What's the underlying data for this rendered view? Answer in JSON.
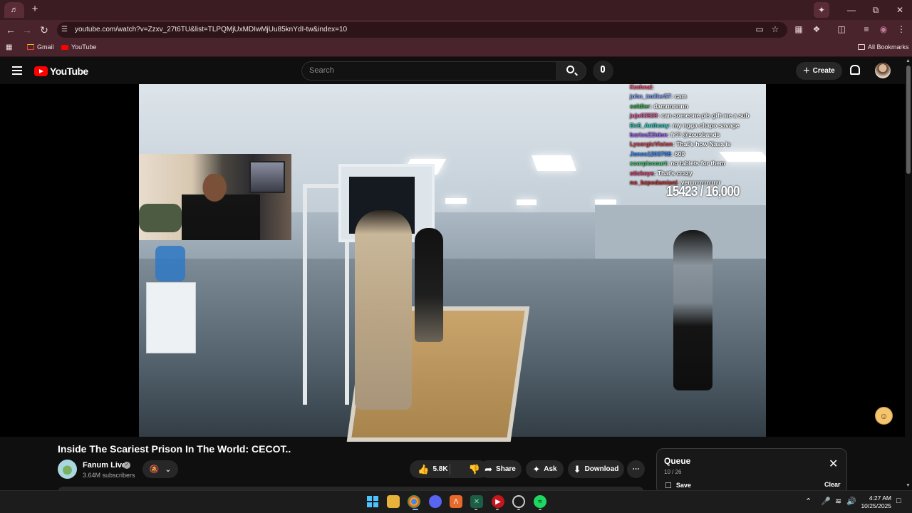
{
  "browser": {
    "url": "youtube.com/watch?v=Zzxv_27t6TU&list=TLPQMjUxMDIwMjUu85knYdI-tw&index=10",
    "bookmarks": [
      "Gmail",
      "YouTube"
    ],
    "all_bookmarks_label": "All Bookmarks"
  },
  "youtube": {
    "logo_text": "YouTube",
    "search_placeholder": "Search",
    "create_label": "Create"
  },
  "video": {
    "title": "Inside The Scariest Prison In The World: CECOT..",
    "overlay_counter": "15423 / 16,000",
    "chat": [
      {
        "user": "Kmhnal",
        "msg": "",
        "color": "#ff4d6d"
      },
      {
        "user": "john_tmiller57",
        "msg": "cam",
        "color": "#8aa8ff"
      },
      {
        "user": "soldier",
        "msg": "damnnnnnn",
        "color": "#39b54a"
      },
      {
        "user": "juju63829",
        "msg": "can someone pls gift me a sub",
        "color": "#e05a9e"
      },
      {
        "user": "Dc5_Anthony",
        "msg": "my ngga chapo savage",
        "color": "#2bd9c6"
      },
      {
        "user": "barissZ2iden",
        "msg": "fr?! @zeusbands",
        "color": "#a55cff"
      },
      {
        "user": "LysergicVision",
        "msg": "That's how Nasa is",
        "color": "#d9414f"
      },
      {
        "user": "Jones1203708",
        "msg": "600",
        "color": "#3a8bff"
      },
      {
        "user": "scorpiocourt",
        "msg": "no tablets for them",
        "color": "#39d36b"
      },
      {
        "user": "stickeys",
        "msg": "That's crazy",
        "color": "#e23a6e"
      },
      {
        "user": "no_bzpedamiani",
        "msg": "yerrrrrrrrrrrrrr",
        "color": "#d03030"
      }
    ]
  },
  "channel": {
    "name": "Fanum Live",
    "subscribers": "3.64M subscribers"
  },
  "actions": {
    "likes": "5.8K",
    "share": "Share",
    "ask": "Ask",
    "download": "Download"
  },
  "queue": {
    "title": "Queue",
    "count": "10 / 26",
    "save": "Save",
    "clear": "Clear"
  },
  "system": {
    "time": "4:27 AM",
    "date": "10/25/2025"
  },
  "icons": [
    "search-icon",
    "mic-icon",
    "bell-icon",
    "like-icon",
    "dislike-icon",
    "share-icon",
    "download-icon",
    "close-icon",
    "save-icon"
  ]
}
